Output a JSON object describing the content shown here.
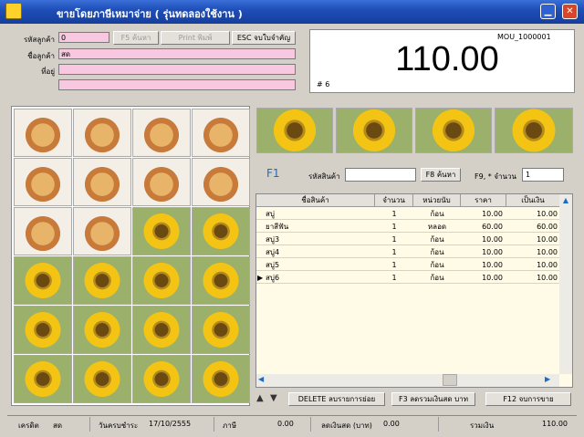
{
  "window": {
    "title": "ขายโดยภาษีเหมาจ่าย ( รุ่นทดลองใช้งาน )"
  },
  "header": {
    "customer_code_label": "รหัสลูกค้า",
    "customer_code_value": "0",
    "customer_name_label": "ชื่อลูกค้า",
    "customer_name_value": "สด",
    "address_label": "ที่อยู่",
    "address_value": "",
    "address_value2": "",
    "f5_search": "F5 ค้นหา",
    "print": "Print พิมพ์",
    "esc_close": "ESC จบใบจำคัญ",
    "doc_no": "MOU_1000001",
    "total": "110.00",
    "counter": "# 6"
  },
  "search": {
    "f1": "F1",
    "product_code_label": "รหัสสินค้า",
    "product_code_value": "",
    "f8_search": "F8 ค้นหา",
    "qty_label": "F9, * จำนวน",
    "qty_value": "1"
  },
  "table": {
    "columns": [
      "ชื่อสินค้า",
      "จำนวน",
      "หน่วยนับ",
      "ราคา",
      "เป็นเงิน"
    ],
    "rows": [
      {
        "name": "สบู่",
        "qty": "1",
        "unit": "ก้อน",
        "price": "10.00",
        "amount": "10.00"
      },
      {
        "name": "ยาสีฟัน",
        "qty": "1",
        "unit": "หลอด",
        "price": "60.00",
        "amount": "60.00"
      },
      {
        "name": "สบู่3",
        "qty": "1",
        "unit": "ก้อน",
        "price": "10.00",
        "amount": "10.00"
      },
      {
        "name": "สบู่4",
        "qty": "1",
        "unit": "ก้อน",
        "price": "10.00",
        "amount": "10.00"
      },
      {
        "name": "สบู่5",
        "qty": "1",
        "unit": "ก้อน",
        "price": "10.00",
        "amount": "10.00"
      },
      {
        "name": "สบู่6",
        "qty": "1",
        "unit": "ก้อน",
        "price": "10.00",
        "amount": "10.00"
      }
    ]
  },
  "actions": {
    "delete": "DELETE  ลบรายการย่อย",
    "f3": "F3  ลดรวมเงินสด บาท",
    "f12": "F12  จบการขาย"
  },
  "status": {
    "credit_label": "เครดิต",
    "credit_value": "สด",
    "due_label": "วันครบชำระ",
    "due_value": "17/10/2555",
    "tax_label": "ภาษี",
    "tax_value": "0.00",
    "discount_label": "ลดเงินสด (บาท)",
    "discount_value": "0.00",
    "total_label": "รวมเงิน",
    "total_value": "110.00"
  },
  "colors": {
    "field_pink": "#f8c8e0",
    "title_blue": "#1f4fb8",
    "table_bg": "#fffbe6",
    "f1_blue": "#1c6cc4"
  }
}
